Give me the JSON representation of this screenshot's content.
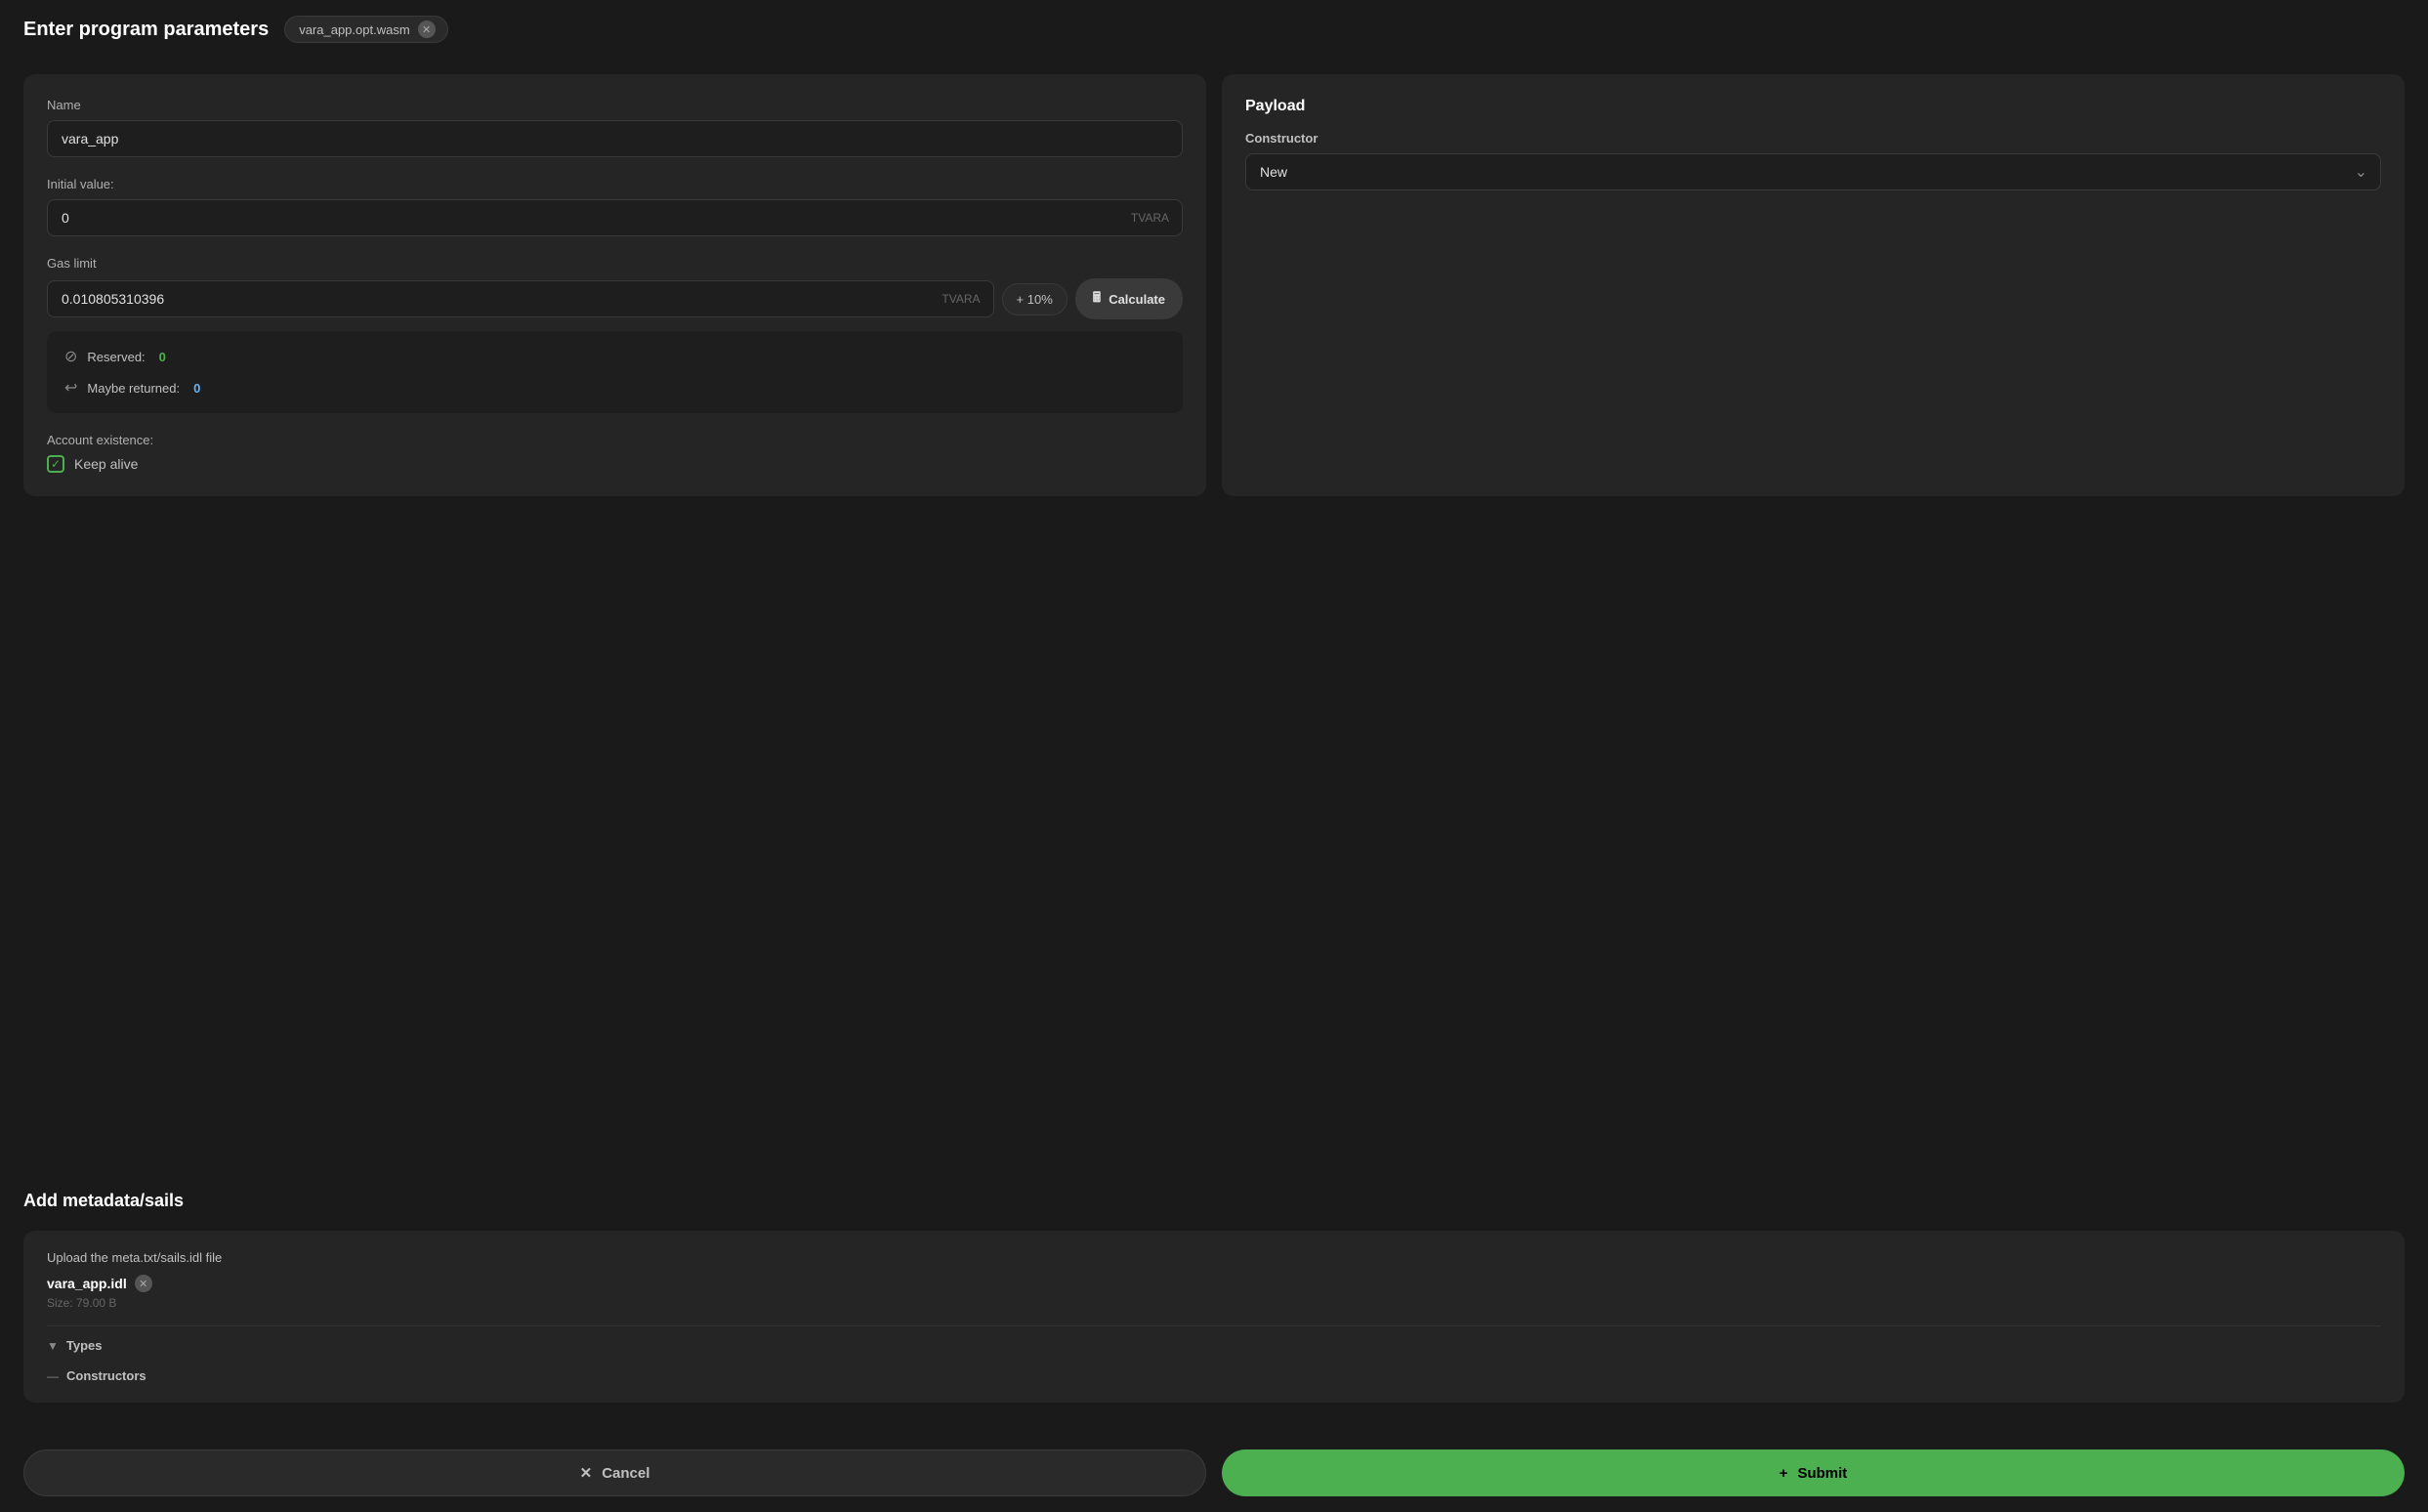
{
  "header": {
    "title": "Enter program parameters",
    "file_tab": {
      "name": "vara_app.opt.wasm",
      "close_icon": "✕"
    }
  },
  "left_panel": {
    "name_label": "Name",
    "name_value": "vara_app",
    "initial_value_label": "Initial value:",
    "initial_value": "0",
    "initial_value_suffix": "TVARA",
    "gas_limit_label": "Gas limit",
    "gas_limit_value": "0.010805310396",
    "gas_limit_suffix": "TVARA",
    "plus10_label": "+ 10%",
    "calculate_label": "Calculate",
    "reserved_label": "Reserved:",
    "reserved_value": "0",
    "maybe_returned_label": "Maybe returned:",
    "maybe_returned_value": "0",
    "account_existence_label": "Account existence:",
    "keep_alive_label": "Keep alive"
  },
  "right_panel": {
    "title": "Payload",
    "constructor_label": "Constructor",
    "constructor_value": "New",
    "constructor_options": [
      "New"
    ]
  },
  "bottom_section": {
    "title": "Add metadata/sails",
    "upload_label": "Upload the meta.txt/sails.idl file",
    "file_name": "vara_app.idl",
    "file_size": "Size: 79.00 B",
    "types_label": "Types",
    "constructors_label": "Constructors"
  },
  "action_bar": {
    "cancel_label": "Cancel",
    "cancel_icon": "✕",
    "submit_label": "Submit",
    "submit_icon": "+"
  }
}
